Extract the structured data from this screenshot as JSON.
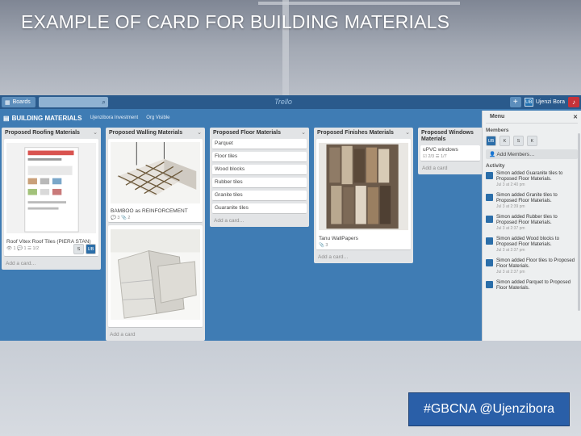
{
  "slide": {
    "title": "EXAMPLE OF CARD FOR BUILDING MATERIALS",
    "hashtag": "#GBCNA @Ujenzibora"
  },
  "topbar": {
    "boards_label": "Boards",
    "search_icon": "search-icon",
    "logo": "Trello",
    "add_label": "+",
    "user_initials": "UB",
    "user_name": "Ujenzi Bora",
    "alert_icon": "bell-icon"
  },
  "board": {
    "name": "BUILDING MATERIALS",
    "team": "Ujenzibora Investment",
    "visibility": "Org Visible"
  },
  "lists": [
    {
      "title": "Proposed Roofing Materials",
      "cards": [
        {
          "text": "Roof Vitex Roof Tiles (PIERA STAN)",
          "badges": "👁 1   💬 1   ☰ 1/2",
          "image": "screenshot",
          "members": [
            "S",
            "UB"
          ]
        }
      ],
      "add": "Add a card…"
    },
    {
      "title": "Proposed Walling Materials",
      "cards": [
        {
          "text": "BAMBOO as REINFORCEMENT",
          "badges": "💬 3   📎 2",
          "image": "bamboo"
        },
        {
          "text": "",
          "badges": "",
          "image": "blocks"
        }
      ],
      "add": "Add a card"
    },
    {
      "title": "Proposed Floor Materials",
      "cards": [
        {
          "text": "Parquet"
        },
        {
          "text": "Floor tiles"
        },
        {
          "text": "Wood blocks"
        },
        {
          "text": "Rubber tiles"
        },
        {
          "text": "Granite tiles"
        },
        {
          "text": "Guaranite tiles"
        }
      ],
      "add": "Add a card…"
    },
    {
      "title": "Proposed Finishes Materials",
      "cards": [
        {
          "text": "Tanu WallPapers",
          "badges": "📎 3",
          "image": "wallpaper"
        }
      ],
      "add": "Add a card…"
    },
    {
      "title": "Proposed Windows Materials",
      "cards": [
        {
          "text": "uPVC windows",
          "badges": "☑ 2/3   ☰ 1/7"
        }
      ],
      "add": "Add a card"
    }
  ],
  "sidebar": {
    "title": "Menu",
    "close": "✕",
    "members_label": "Members",
    "members": [
      "UB",
      "K",
      "S",
      "K"
    ],
    "add_members": "Add Members…",
    "activity_label": "Activity",
    "activity": [
      {
        "text": "Simon added Guaranite tiles to Proposed Floor Materials.",
        "time": "Jul 3 at 2:40 pm"
      },
      {
        "text": "Simon added Granite tiles to Proposed Floor Materials.",
        "time": "Jul 3 at 2:39 pm"
      },
      {
        "text": "Simon added Rubber tiles to Proposed Floor Materials.",
        "time": "Jul 3 at 2:37 pm"
      },
      {
        "text": "Simon added Wood blocks to Proposed Floor Materials.",
        "time": "Jul 3 at 2:37 pm"
      },
      {
        "text": "Simon added Floor tiles to Proposed Floor Materials.",
        "time": "Jul 3 at 2:37 pm"
      },
      {
        "text": "Simon added Parquet to Proposed Floor Materials.",
        "time": ""
      }
    ]
  },
  "colors": {
    "trello_blue": "#3f7cb4",
    "topbar": "#2a5a8c",
    "hashtag_bg": "#2a5fa8"
  }
}
